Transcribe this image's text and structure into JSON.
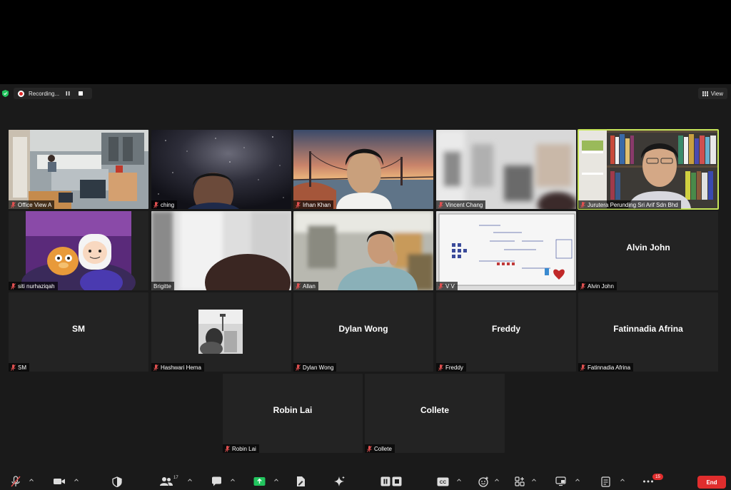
{
  "topbar": {
    "recording_label": "Recording...",
    "view_label": "View"
  },
  "participants": [
    {
      "name": "Office View A",
      "video": "office",
      "muted": true
    },
    {
      "name": "ching",
      "video": "space",
      "muted": true
    },
    {
      "name": "Irhan Khan",
      "video": "bridge",
      "muted": true
    },
    {
      "name": "Vincent Chang",
      "video": "blur",
      "muted": true
    },
    {
      "name": "Jurutera Perunding Sri Arif Sdn Bhd",
      "video": "bookshelf",
      "muted": true,
      "active_speaker": true
    },
    {
      "name": "siti nurhaziqah",
      "video": "cartoon",
      "muted": true
    },
    {
      "name": "Brigitte",
      "video": "white-room",
      "muted": false
    },
    {
      "name": "Allan",
      "video": "office-man",
      "muted": true
    },
    {
      "name": "V V",
      "video": "whiteboard",
      "muted": true
    },
    {
      "name": "Alvin John",
      "display": "Alvin John",
      "muted": true
    },
    {
      "name": "SM",
      "display": "SM",
      "muted": true
    },
    {
      "name": "Hashwari Hema",
      "video": "avatar-photo",
      "muted": true
    },
    {
      "name": "Dylan Wong",
      "display": "Dylan Wong",
      "muted": true
    },
    {
      "name": "Freddy",
      "display": "Freddy",
      "muted": true
    },
    {
      "name": "Fatinnadia Afrina",
      "display": "Fatinnadia Afrina",
      "muted": true
    },
    {
      "name": "Robin Lai",
      "display": "Robin Lai",
      "muted": true
    },
    {
      "name": "Collete",
      "display": "Collete",
      "muted": true
    }
  ],
  "toolbar": {
    "participants_count": "17",
    "chat_badge": "15",
    "end_label": "End"
  },
  "colors": {
    "accent_green": "#c7e65a",
    "end_red": "#e02d2d",
    "muted_red": "#e05050",
    "share_green": "#22c55e"
  },
  "icons": [
    "shield-icon",
    "record-dot-icon",
    "pause-icon",
    "stop-icon",
    "grid-icon",
    "mic-off-icon",
    "video-icon",
    "security-icon",
    "participants-icon",
    "chat-icon",
    "share-screen-icon",
    "whiteboard-icon",
    "ai-sparkle-icon",
    "pause-recording-icon",
    "captions-icon",
    "reactions-icon",
    "apps-icon",
    "view-icon",
    "notes-icon",
    "more-icon"
  ]
}
